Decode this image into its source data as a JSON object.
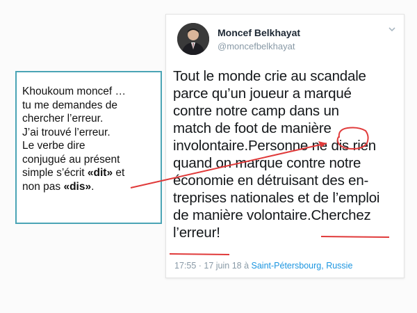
{
  "note": {
    "line1": "Khoukoum moncef …",
    "line2": "tu me demandes de",
    "line3": "chercher l’erreur.",
    "line4": "J’ai trouvé l’erreur.",
    "line5": "Le verbe dire",
    "line6": "conjugué au présent",
    "line7_prefix": "simple s’écrit ",
    "line7_bold": "«dit»",
    "line7_suffix": " et",
    "line8_prefix": "non pas ",
    "line8_bold": "«dis»",
    "line8_suffix": "."
  },
  "tweet": {
    "name": "Moncef Belkhayat",
    "handle": "@moncefbelkhayat",
    "lines": [
      "Tout le monde crie au scandale",
      "parce qu’un joueur a marqué",
      "contre notre camp dans un",
      "match de foot de manière",
      "involontaire.Personne ne dis rien",
      "quand on marque contre notre",
      "économie  en détruisant des en-",
      "treprises nationales et de l’emploi",
      "de manière volontaire.Cherchez",
      "l’erreur!"
    ],
    "time": "17:55 · 17 juin 18 à ",
    "location": "Saint-Pétersbourg, Russie"
  },
  "colors": {
    "note_border": "#4aa4b5",
    "annotation_red": "#e03a3a",
    "link_blue": "#1b95e0",
    "muted": "#8899a6"
  },
  "icons": {
    "avatar": "profile-photo",
    "chevron": "chevron-down-icon"
  }
}
